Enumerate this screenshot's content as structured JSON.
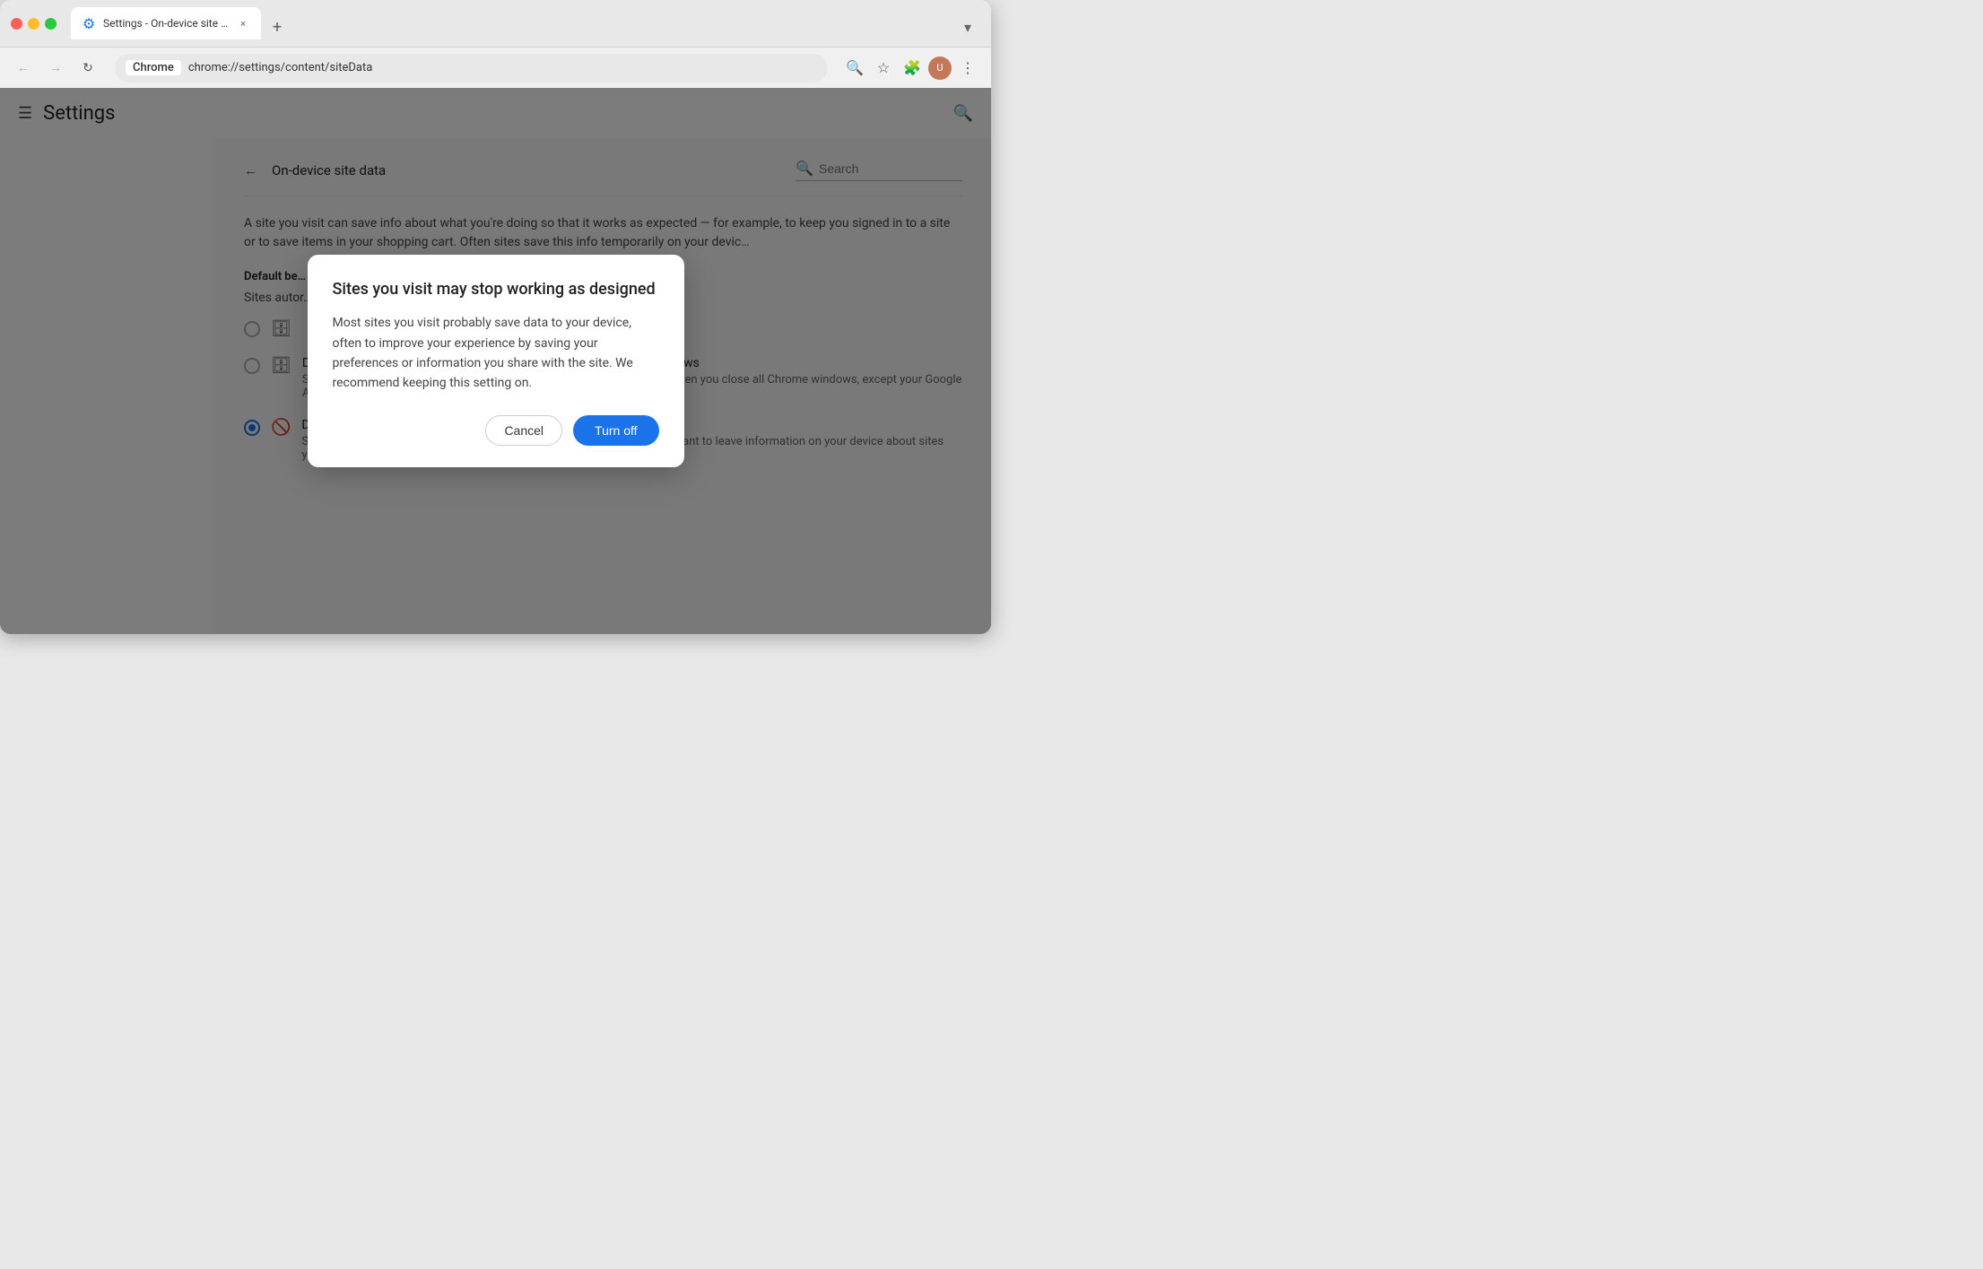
{
  "browser": {
    "tab": {
      "favicon": "⚙",
      "title": "Settings - On-device site da…",
      "close_label": "×"
    },
    "new_tab_label": "+",
    "dropdown_label": "▾",
    "nav": {
      "back_label": "←",
      "forward_label": "→",
      "refresh_label": "↻",
      "chrome_label": "Chrome",
      "url": "chrome://settings/content/siteData",
      "zoom_label": "🔍",
      "star_label": "☆",
      "extensions_label": "🧩",
      "menu_label": "⋮"
    }
  },
  "settings": {
    "header": {
      "menu_label": "☰",
      "title": "Settings",
      "search_label": "🔍"
    },
    "page": {
      "back_label": "←",
      "title": "On-device site data",
      "search_placeholder": "Search"
    },
    "description": "A site you visit can save info about what you're doing so that it works as expected — for example, to keep you signed in to a site or to save items in your shopping cart. Often sites save this info temporarily on your devic…",
    "default_behavior_label": "Default be…",
    "sites_auto_label": "Sites autor…",
    "options": [
      {
        "id": "opt1",
        "selected": false,
        "icon": "🗄",
        "title": "",
        "subtitle": ""
      },
      {
        "id": "opt2",
        "selected": false,
        "icon": "🗄",
        "title": "Delete data sites have saved to your device when you close all windows",
        "subtitle": "Sites will probably work as expected. You'll be signed out of most sites when you close all Chrome windows, except your Google Account if you're signed in to Chrome."
      },
      {
        "id": "opt3",
        "selected": true,
        "icon": "🚫",
        "title": "Don't allow sites to save data on your device (not recommended)",
        "subtitle": "Sites may not work as you would expect. Choose this option if you don't want to leave information on your device about sites you visit."
      }
    ]
  },
  "modal": {
    "title": "Sites you visit may stop working as designed",
    "body": "Most sites you visit probably save data to your device, often to improve your experience by saving your preferences or information you share with the site. We recommend keeping this setting on.",
    "cancel_label": "Cancel",
    "turn_off_label": "Turn off"
  }
}
